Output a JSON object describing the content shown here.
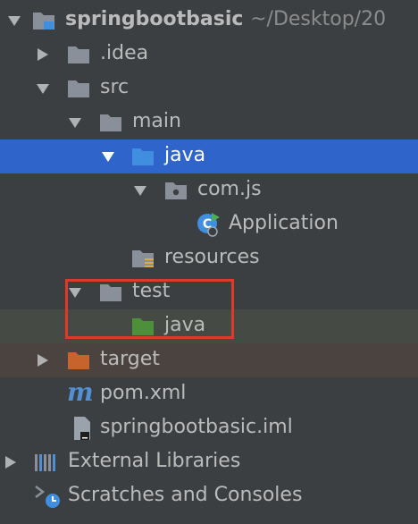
{
  "project": {
    "name": "springbootbasic",
    "path": "~/Desktop/20"
  },
  "nodes": {
    "idea": ".idea",
    "src": "src",
    "main": "main",
    "main_java": "java",
    "package": "com.js",
    "application": "Application",
    "resources": "resources",
    "test": "test",
    "test_java": "java",
    "target": "target",
    "pom": "pom.xml",
    "iml": "springbootbasic.iml",
    "external_libraries": "External Libraries",
    "scratches": "Scratches and Consoles"
  },
  "colors": {
    "selection": "#2f65ca",
    "folder": "#8a9099",
    "source_folder": "#3f8ee0",
    "test_folder": "#4e8f3a",
    "excluded_folder": "#c7642e",
    "maven": "#5290d4",
    "highlight_border": "#e0392b"
  },
  "icons": {
    "expanded": "triangle-down",
    "collapsed": "triangle-right"
  }
}
